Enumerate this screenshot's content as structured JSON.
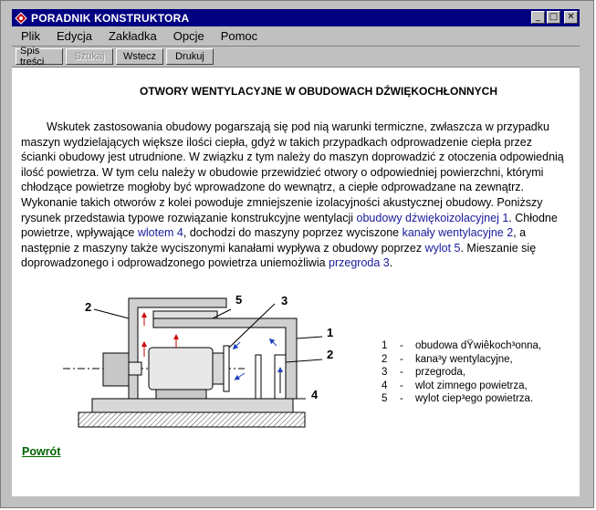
{
  "window": {
    "title": "PORADNIK KONSTRUKTORA",
    "controls": {
      "minimize": "_",
      "maximize": "□",
      "close": "✕"
    }
  },
  "menu": [
    {
      "label": "Plik"
    },
    {
      "label": "Edycja"
    },
    {
      "label": "Zakładka"
    },
    {
      "label": "Opcje"
    },
    {
      "label": "Pomoc"
    }
  ],
  "toolbar": {
    "contents": "Spis treści",
    "search": "Szukaj",
    "back": "Wstecz",
    "print": "Drukuj"
  },
  "page": {
    "heading": "OTWORY WENTYLACYJNE W OBUDOWACH DŹWIĘKOCHŁONNYCH",
    "para": {
      "t1": "Wskutek zastosowania obudowy pogarszają się pod nią warunki termiczne, zwłaszcza w przypadku maszyn wydzielających większe ilości ciepła, gdyż w takich przypadkach odprowadzenie ciepła przez ścianki obudowy jest utrudnione. W związku z tym należy do maszyn doprowadzić z otoczenia odpowiednią ilość powietrza. W tym celu należy w obudowie przewidzieć otwory o odpowiedniej powierzchni, którymi chłodzące powietrze mogłoby być wprowadzone do wewnątrz, a ciepłe odprowadzane na zewnątrz. Wykonanie takich otworów z kolei powoduje zmniejszenie izolacyjności akustycznej obudowy. Poniższy rysunek przedstawia typowe rozwiązanie konstrukcyjne wentylacji ",
      "l1": "obudowy dźwiękoizolacyjnej 1",
      "t2": ". Chłodne powietrze, wpływające  ",
      "l2": "wlotem 4",
      "t3": ", dochodzi do maszyny poprzez wyciszone ",
      "l3": "kanały wentylacyjne 2",
      "t4": ", a następnie z maszyny także wyciszonymi kanałami wypływa z obudowy poprzez ",
      "l4": "wylot 5",
      "t5": ". Mieszanie się doprowadzonego i odprowadzonego powietrza uniemożliwia ",
      "l5": "przegroda 3",
      "t6": "."
    },
    "diagram_labels": {
      "n1": "1",
      "n2a": "2",
      "n2b": "2",
      "n3": "3",
      "n4": "4",
      "n5": "5"
    },
    "legend": [
      {
        "num": "1",
        "dash": "-",
        "text": "obudowa dŸwiêkoch³onna,"
      },
      {
        "num": "2",
        "dash": "-",
        "text": "kana³y wentylacyjne,"
      },
      {
        "num": "3",
        "dash": "-",
        "text": "przegroda,"
      },
      {
        "num": "4",
        "dash": "-",
        "text": "wlot zimnego powietrza,"
      },
      {
        "num": "5",
        "dash": "-",
        "text": "wylot ciep³ego powietrza."
      }
    ],
    "back_link": "Powrót"
  },
  "colors": {
    "titlebar": "#000080",
    "link": "#1a1a9c",
    "back_link": "#006400",
    "arrow_hot": "#cc0000",
    "arrow_cold": "#2040c0"
  }
}
